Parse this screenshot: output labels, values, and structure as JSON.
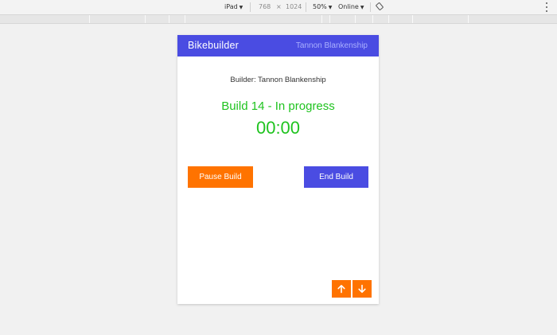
{
  "devtools": {
    "device": "iPad",
    "width": "768",
    "times": "×",
    "height": "1024",
    "zoom": "50%",
    "network": "Online"
  },
  "app": {
    "title": "Bikebuilder",
    "user": "Tannon Blankenship",
    "builder_line": "Builder: Tannon Blankenship",
    "status": "Build 14 - In progress",
    "timer": "00:00",
    "pause_label": "Pause Build",
    "end_label": "End Build"
  },
  "colors": {
    "header": "#4a4ce2",
    "accent_orange": "#ff7300",
    "status_green": "#1fc31f"
  },
  "icons": {
    "rotate": "rotate-icon",
    "menu": "more-vertical-icon",
    "up": "arrow-up-icon",
    "down": "arrow-down-icon"
  }
}
